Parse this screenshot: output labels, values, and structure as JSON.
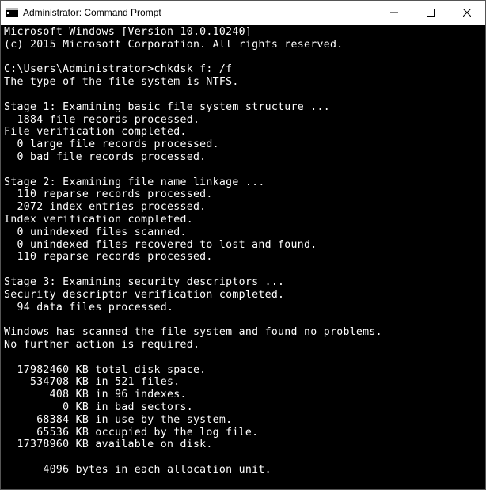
{
  "titlebar": {
    "title": "Administrator: Command Prompt"
  },
  "terminal": {
    "lines": [
      "Microsoft Windows [Version 10.0.10240]",
      "(c) 2015 Microsoft Corporation. All rights reserved.",
      "",
      "C:\\Users\\Administrator>chkdsk f: /f",
      "The type of the file system is NTFS.",
      "",
      "Stage 1: Examining basic file system structure ...",
      "  1884 file records processed.",
      "File verification completed.",
      "  0 large file records processed.",
      "  0 bad file records processed.",
      "",
      "Stage 2: Examining file name linkage ...",
      "  110 reparse records processed.",
      "  2072 index entries processed.",
      "Index verification completed.",
      "  0 unindexed files scanned.",
      "  0 unindexed files recovered to lost and found.",
      "  110 reparse records processed.",
      "",
      "Stage 3: Examining security descriptors ...",
      "Security descriptor verification completed.",
      "  94 data files processed.",
      "",
      "Windows has scanned the file system and found no problems.",
      "No further action is required.",
      "",
      "  17982460 KB total disk space.",
      "    534708 KB in 521 files.",
      "       408 KB in 96 indexes.",
      "         0 KB in bad sectors.",
      "     68384 KB in use by the system.",
      "     65536 KB occupied by the log file.",
      "  17378960 KB available on disk.",
      "",
      "      4096 bytes in each allocation unit."
    ]
  }
}
